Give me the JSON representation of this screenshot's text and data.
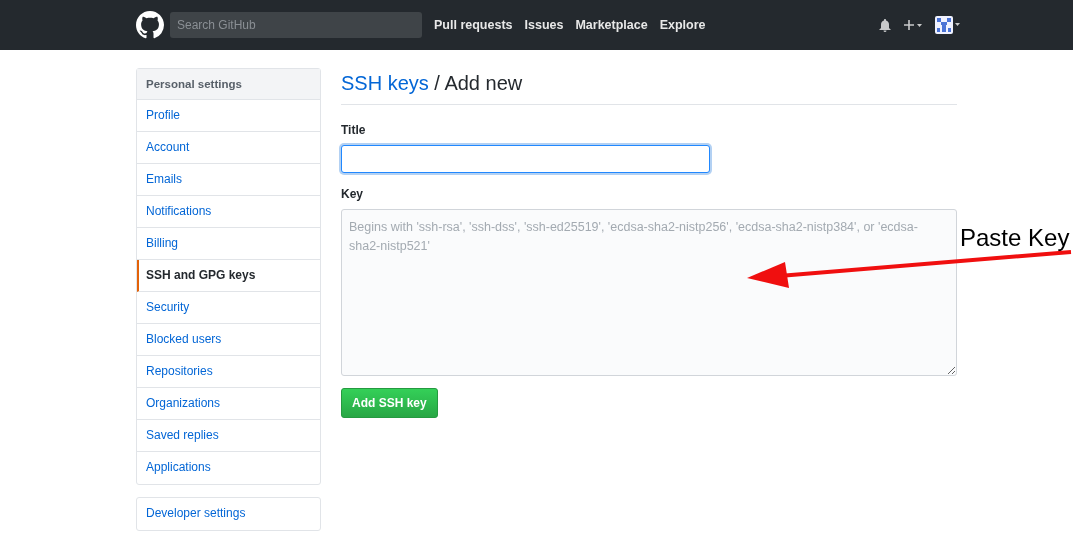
{
  "header": {
    "search": {
      "placeholder": "Search GitHub"
    },
    "nav": [
      "Pull requests",
      "Issues",
      "Marketplace",
      "Explore"
    ]
  },
  "sidebar": {
    "heading": "Personal settings",
    "items": [
      {
        "label": "Profile",
        "selected": false
      },
      {
        "label": "Account",
        "selected": false
      },
      {
        "label": "Emails",
        "selected": false
      },
      {
        "label": "Notifications",
        "selected": false
      },
      {
        "label": "Billing",
        "selected": false
      },
      {
        "label": "SSH and GPG keys",
        "selected": true
      },
      {
        "label": "Security",
        "selected": false
      },
      {
        "label": "Blocked users",
        "selected": false
      },
      {
        "label": "Repositories",
        "selected": false
      },
      {
        "label": "Organizations",
        "selected": false
      },
      {
        "label": "Saved replies",
        "selected": false
      },
      {
        "label": "Applications",
        "selected": false
      }
    ],
    "extra": [
      "Developer settings"
    ]
  },
  "main": {
    "breadcrumb_link": "SSH keys",
    "title": " / Add new",
    "fields": [
      {
        "label": "Title",
        "kind": "input",
        "focused": true
      },
      {
        "label": "Key",
        "kind": "textarea",
        "placeholder": "Begins with 'ssh-rsa', 'ssh-dss', 'ssh-ed25519', 'ecdsa-sha2-nistp256', 'ecdsa-sha2-nistp384', or 'ecdsa-sha2-nistp521'"
      }
    ],
    "button": "Add SSH key"
  },
  "annotation": {
    "text": "Paste Key"
  }
}
